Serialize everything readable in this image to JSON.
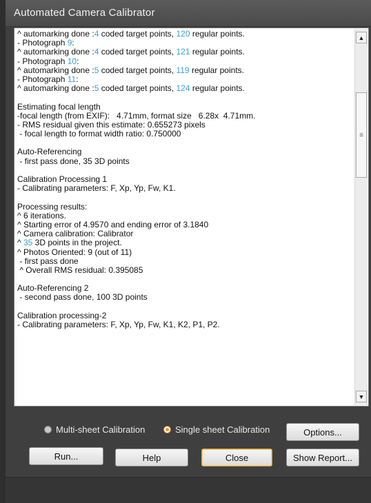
{
  "window": {
    "title": "Automated Camera Calibrator"
  },
  "log": {
    "lines": [
      [
        {
          "t": "^ automarking done :"
        },
        {
          "t": "4",
          "h": true
        },
        {
          "t": " coded target points, "
        },
        {
          "t": "120",
          "h": true
        },
        {
          "t": " regular points."
        }
      ],
      [
        {
          "t": "- Photograph "
        },
        {
          "t": "9",
          "h": true
        },
        {
          "t": ":"
        }
      ],
      [
        {
          "t": "^ automarking done :"
        },
        {
          "t": "4",
          "h": true
        },
        {
          "t": " coded target points, "
        },
        {
          "t": "121",
          "h": true
        },
        {
          "t": " regular points."
        }
      ],
      [
        {
          "t": "- Photograph "
        },
        {
          "t": "10",
          "h": true
        },
        {
          "t": ":"
        }
      ],
      [
        {
          "t": "^ automarking done :"
        },
        {
          "t": "5",
          "h": true
        },
        {
          "t": " coded target points, "
        },
        {
          "t": "119",
          "h": true
        },
        {
          "t": " regular points."
        }
      ],
      [
        {
          "t": "- Photograph "
        },
        {
          "t": "11",
          "h": true
        },
        {
          "t": ":"
        }
      ],
      [
        {
          "t": "^ automarking done :"
        },
        {
          "t": "5",
          "h": true
        },
        {
          "t": " coded target points, "
        },
        {
          "t": "124",
          "h": true
        },
        {
          "t": " regular points."
        }
      ],
      [],
      [
        {
          "t": "Estimating focal length"
        }
      ],
      [
        {
          "t": "-focal length (from EXIF):   4.71mm, format size   6.28x  4.71mm."
        }
      ],
      [
        {
          "t": "- RMS residual given this estimate: 0.655273 pixels"
        }
      ],
      [
        {
          "t": " - focal length to format width ratio: 0.750000"
        }
      ],
      [],
      [
        {
          "t": "Auto-Referencing"
        }
      ],
      [
        {
          "t": " - first pass done, 35 3D points"
        }
      ],
      [],
      [
        {
          "t": "Calibration Processing 1"
        }
      ],
      [
        {
          "t": "- Calibrating parameters: F, Xp, Yp, Fw, K1."
        }
      ],
      [],
      [
        {
          "t": "Processing results:"
        }
      ],
      [
        {
          "t": "^ 6 iterations."
        }
      ],
      [
        {
          "t": "^ Starting error of 4.9570 and ending error of 3.1840"
        }
      ],
      [
        {
          "t": "^ Camera calibration: Calibrator"
        }
      ],
      [
        {
          "t": "^ "
        },
        {
          "t": "35",
          "h": true
        },
        {
          "t": " 3D points in the project."
        }
      ],
      [
        {
          "t": "^ Photos Oriented: 9 (out of 11)"
        }
      ],
      [
        {
          "t": " - first pass done"
        }
      ],
      [
        {
          "t": " ^ Overall RMS residual: 0.395085"
        }
      ],
      [],
      [
        {
          "t": "Auto-Referencing 2"
        }
      ],
      [
        {
          "t": " - second pass done, 100 3D points"
        }
      ],
      [],
      [
        {
          "t": "Calibration processing-2"
        }
      ],
      [
        {
          "t": "- Calibrating parameters: F, Xp, Yp, Fw, K1, K2, P1, P2."
        }
      ]
    ]
  },
  "options": {
    "multi_sheet_label": "Multi-sheet Calibration",
    "single_sheet_label": "Single sheet Calibration",
    "selected": "single"
  },
  "buttons": {
    "options": "Options...",
    "run": "Run...",
    "help": "Help",
    "close": "Close",
    "show_report": "Show Report..."
  },
  "icons": {
    "scroll_up": "triangle-up-icon",
    "scroll_down": "triangle-down-icon",
    "scroll_grip": "grip-lines-icon"
  },
  "colors": {
    "highlight": "#39a0d8",
    "radio_checked": "#f0931f",
    "focus_border": "#d8a43c"
  }
}
